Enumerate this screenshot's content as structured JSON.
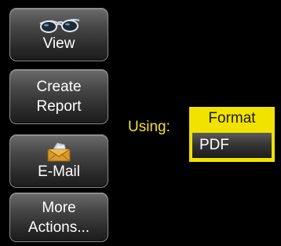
{
  "sidebar": {
    "view": {
      "label": "View",
      "icon": "glasses-icon"
    },
    "create_report": {
      "line1": "Create",
      "line2": "Report"
    },
    "email": {
      "label": "E-Mail",
      "icon": "envelope-icon"
    },
    "more_actions": {
      "line1": "More",
      "line2": "Actions..."
    }
  },
  "using": {
    "label": "Using:",
    "header": "Format",
    "selected": "PDF"
  },
  "colors": {
    "accent_yellow": "#f2e200",
    "label_yellow": "#f2e12a",
    "background": "#000000"
  }
}
